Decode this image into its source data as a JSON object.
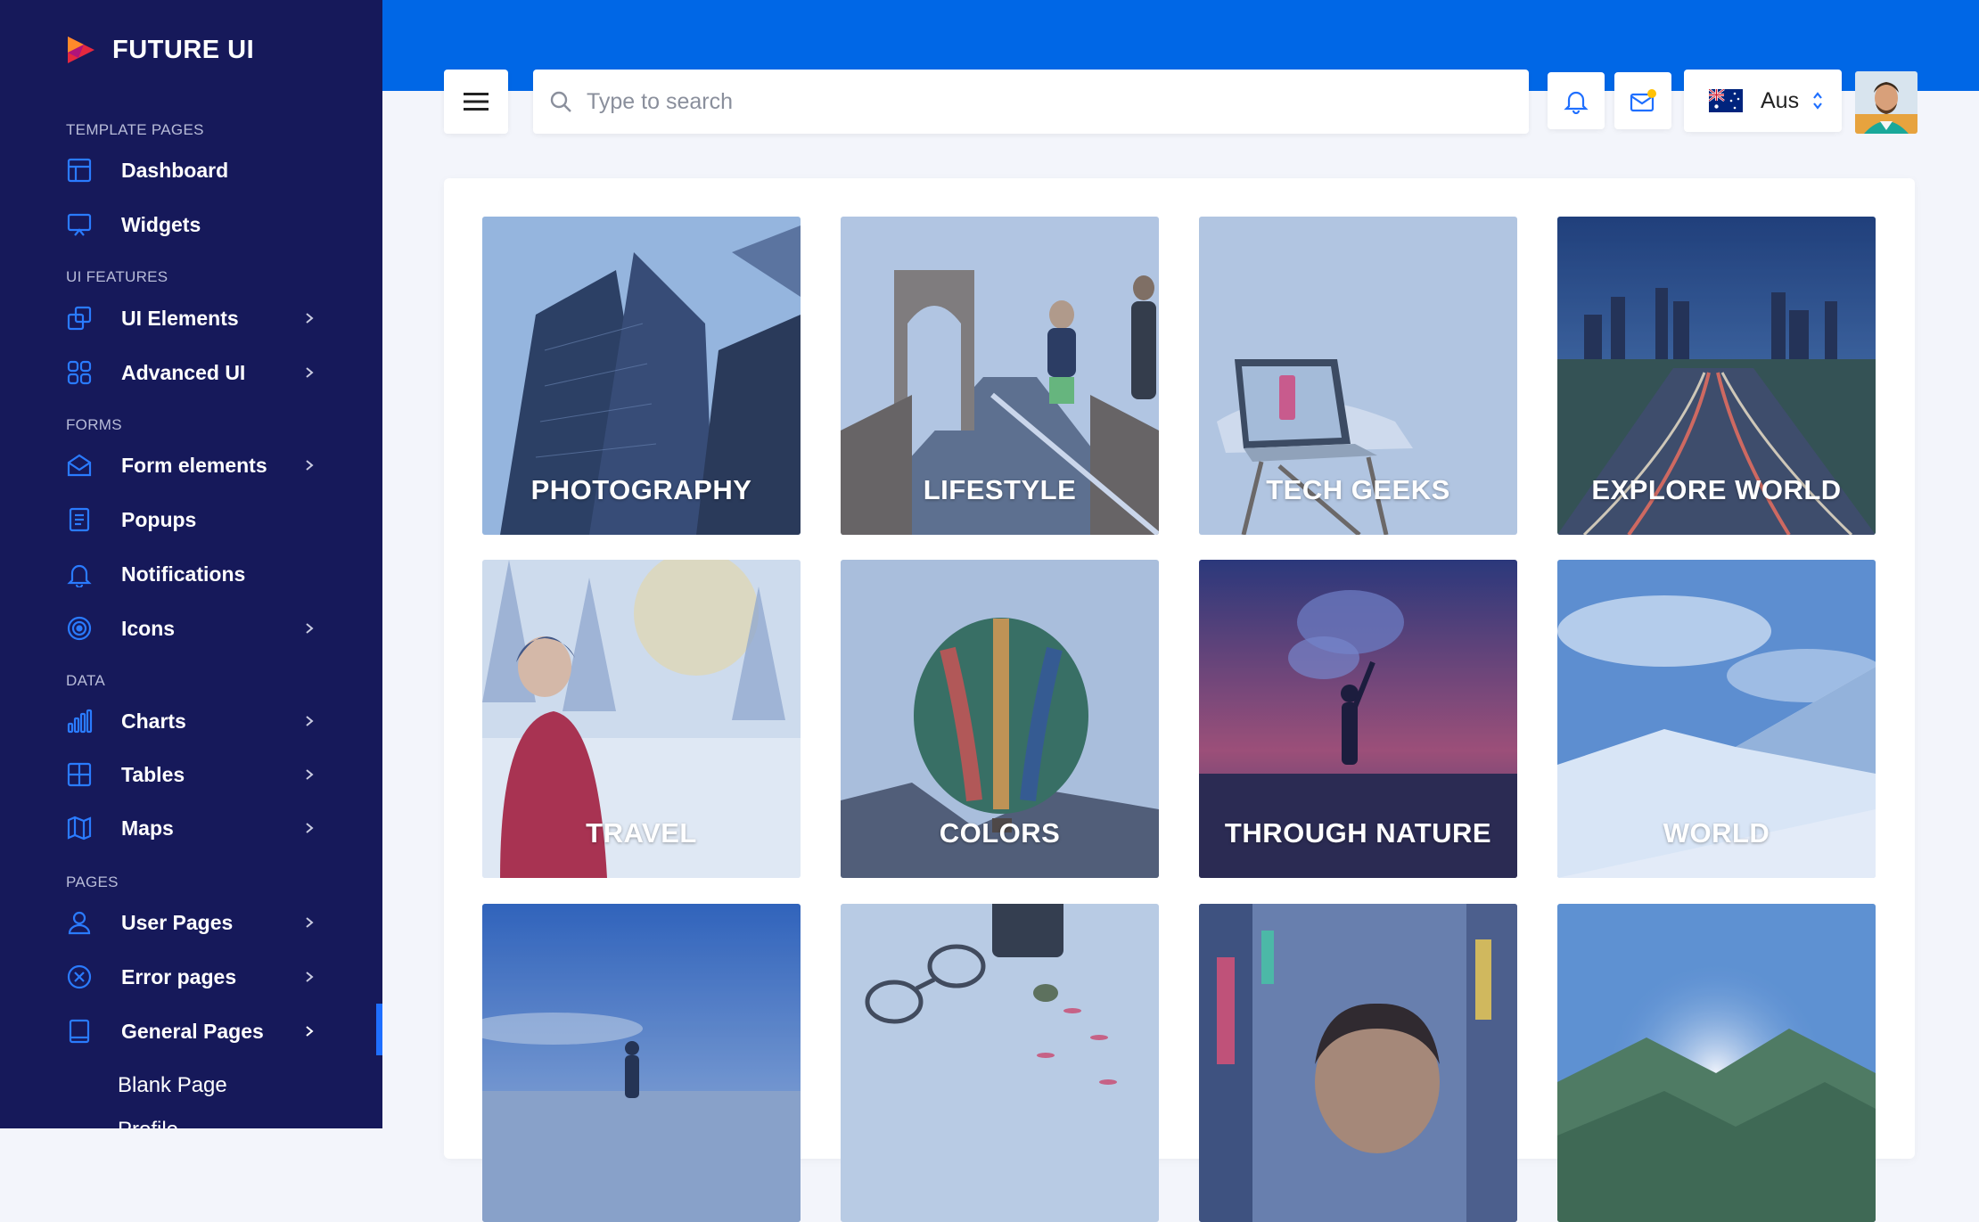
{
  "sidebar": {
    "brand": "FUTURE UI",
    "sections": {
      "template_pages": "TEMPLATE PAGES",
      "ui_features": "UI FEATURES",
      "forms": "FORMS",
      "data": "DATA",
      "pages": "PAGES"
    },
    "items": {
      "dashboard": "Dashboard",
      "widgets": "Widgets",
      "ui_elements": "UI Elements",
      "advanced_ui": "Advanced UI",
      "form_elements": "Form elements",
      "popups": "Popups",
      "notifications": "Notifications",
      "icons": "Icons",
      "charts": "Charts",
      "tables": "Tables",
      "maps": "Maps",
      "user_pages": "User Pages",
      "error_pages": "Error pages",
      "general_pages": "General Pages"
    },
    "sub_items": [
      "Blank Page",
      "Profile"
    ]
  },
  "header": {
    "search_placeholder": "Type to search",
    "language": "Aus"
  },
  "gallery": {
    "tiles": [
      "PHOTOGRAPHY",
      "LIFESTYLE",
      "TECH GEEKS",
      "EXPLORE WORLD",
      "TRAVEL",
      "COLORS",
      "THROUGH NATURE",
      "WORLD",
      "",
      "",
      "",
      ""
    ]
  },
  "colors": {
    "sidebar_bg": "#16195a",
    "top_band": "#0067e6",
    "accent": "#1f6fff",
    "icon_blue": "#2a7bff"
  }
}
